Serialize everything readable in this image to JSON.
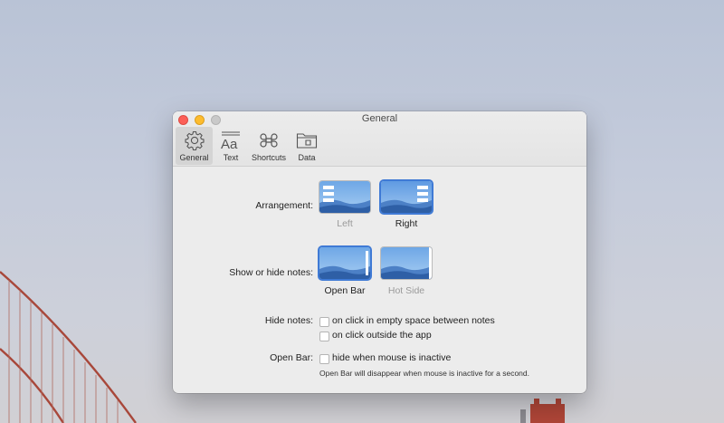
{
  "window": {
    "title": "General"
  },
  "toolbar": {
    "items": [
      {
        "label": "General",
        "icon": "gear-icon",
        "active": true
      },
      {
        "label": "Text",
        "icon": "text-format-icon",
        "active": false
      },
      {
        "label": "Shortcuts",
        "icon": "command-icon",
        "active": false
      },
      {
        "label": "Data",
        "icon": "folder-icon",
        "active": false
      }
    ]
  },
  "arrangement": {
    "label": "Arrangement:",
    "options": [
      {
        "label": "Left",
        "selected": false
      },
      {
        "label": "Right",
        "selected": true
      }
    ]
  },
  "show_hide": {
    "label": "Show or hide notes:",
    "options": [
      {
        "label": "Open Bar",
        "selected": true
      },
      {
        "label": "Hot Side",
        "selected": false
      }
    ]
  },
  "hide_notes": {
    "label": "Hide notes:",
    "options": [
      {
        "label": "on click in empty space between notes",
        "checked": false
      },
      {
        "label": "on click outside the app",
        "checked": false
      }
    ]
  },
  "open_bar": {
    "label": "Open Bar:",
    "option": {
      "label": "hide when mouse is inactive",
      "checked": false
    },
    "note": "Open Bar will disappear when mouse is inactive for a second."
  },
  "colors": {
    "accent": "#3f7ad5",
    "window_bg": "#ececec",
    "close": "#fc5f57",
    "minimize": "#fdbc2e"
  }
}
